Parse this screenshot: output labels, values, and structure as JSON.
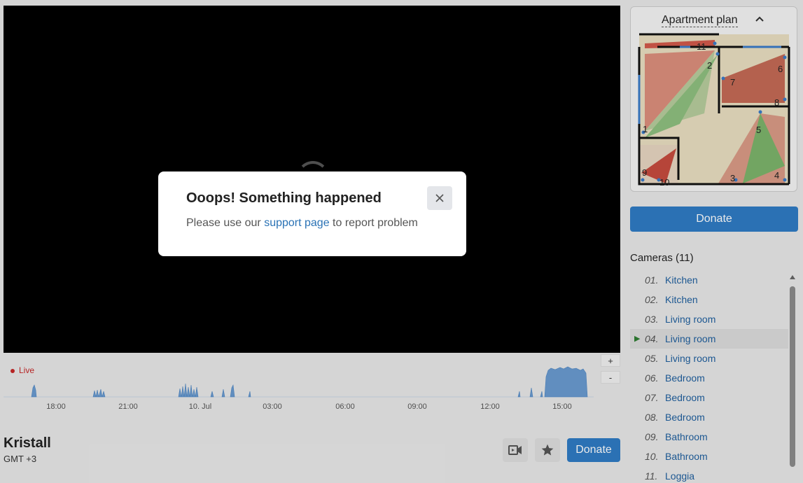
{
  "timeline": {
    "live_label": "Live",
    "ticks": [
      "18:00",
      "21:00",
      "10. Jul",
      "03:00",
      "06:00",
      "09:00",
      "12:00",
      "15:00"
    ],
    "zoom_in": "+",
    "zoom_out": "-"
  },
  "camera_info": {
    "title": "Kristall",
    "timezone": "GMT +3"
  },
  "actions": {
    "record_icon": "video-camera-icon",
    "favorite_icon": "star-icon",
    "donate_label": "Donate"
  },
  "plan": {
    "title": "Apartment plan",
    "toggle_icon": "chevron-up-icon",
    "camera_markers": [
      "1",
      "2",
      "3",
      "4",
      "5",
      "6",
      "7",
      "8",
      "9",
      "10",
      "11"
    ]
  },
  "sidebar": {
    "donate_label": "Donate"
  },
  "cameras": {
    "title": "Cameras (11)",
    "items": [
      {
        "num": "01.",
        "name": "Kitchen"
      },
      {
        "num": "02.",
        "name": "Kitchen"
      },
      {
        "num": "03.",
        "name": "Living room"
      },
      {
        "num": "04.",
        "name": "Living room"
      },
      {
        "num": "05.",
        "name": "Living room"
      },
      {
        "num": "06.",
        "name": "Bedroom"
      },
      {
        "num": "07.",
        "name": "Bedroom"
      },
      {
        "num": "08.",
        "name": "Bedroom"
      },
      {
        "num": "09.",
        "name": "Bathroom"
      },
      {
        "num": "10.",
        "name": "Bathroom"
      },
      {
        "num": "11.",
        "name": "Loggia"
      }
    ],
    "active_index": 3
  },
  "modal": {
    "title": "Ooops! Something happened",
    "text_before": "Please use our ",
    "link_text": "support page",
    "text_after": " to report problem",
    "close_icon": "close-icon"
  },
  "colors": {
    "accent": "#2f7bc4",
    "live": "#c62828",
    "link": "#1f5f9e",
    "activity": "#6a9bd0"
  }
}
